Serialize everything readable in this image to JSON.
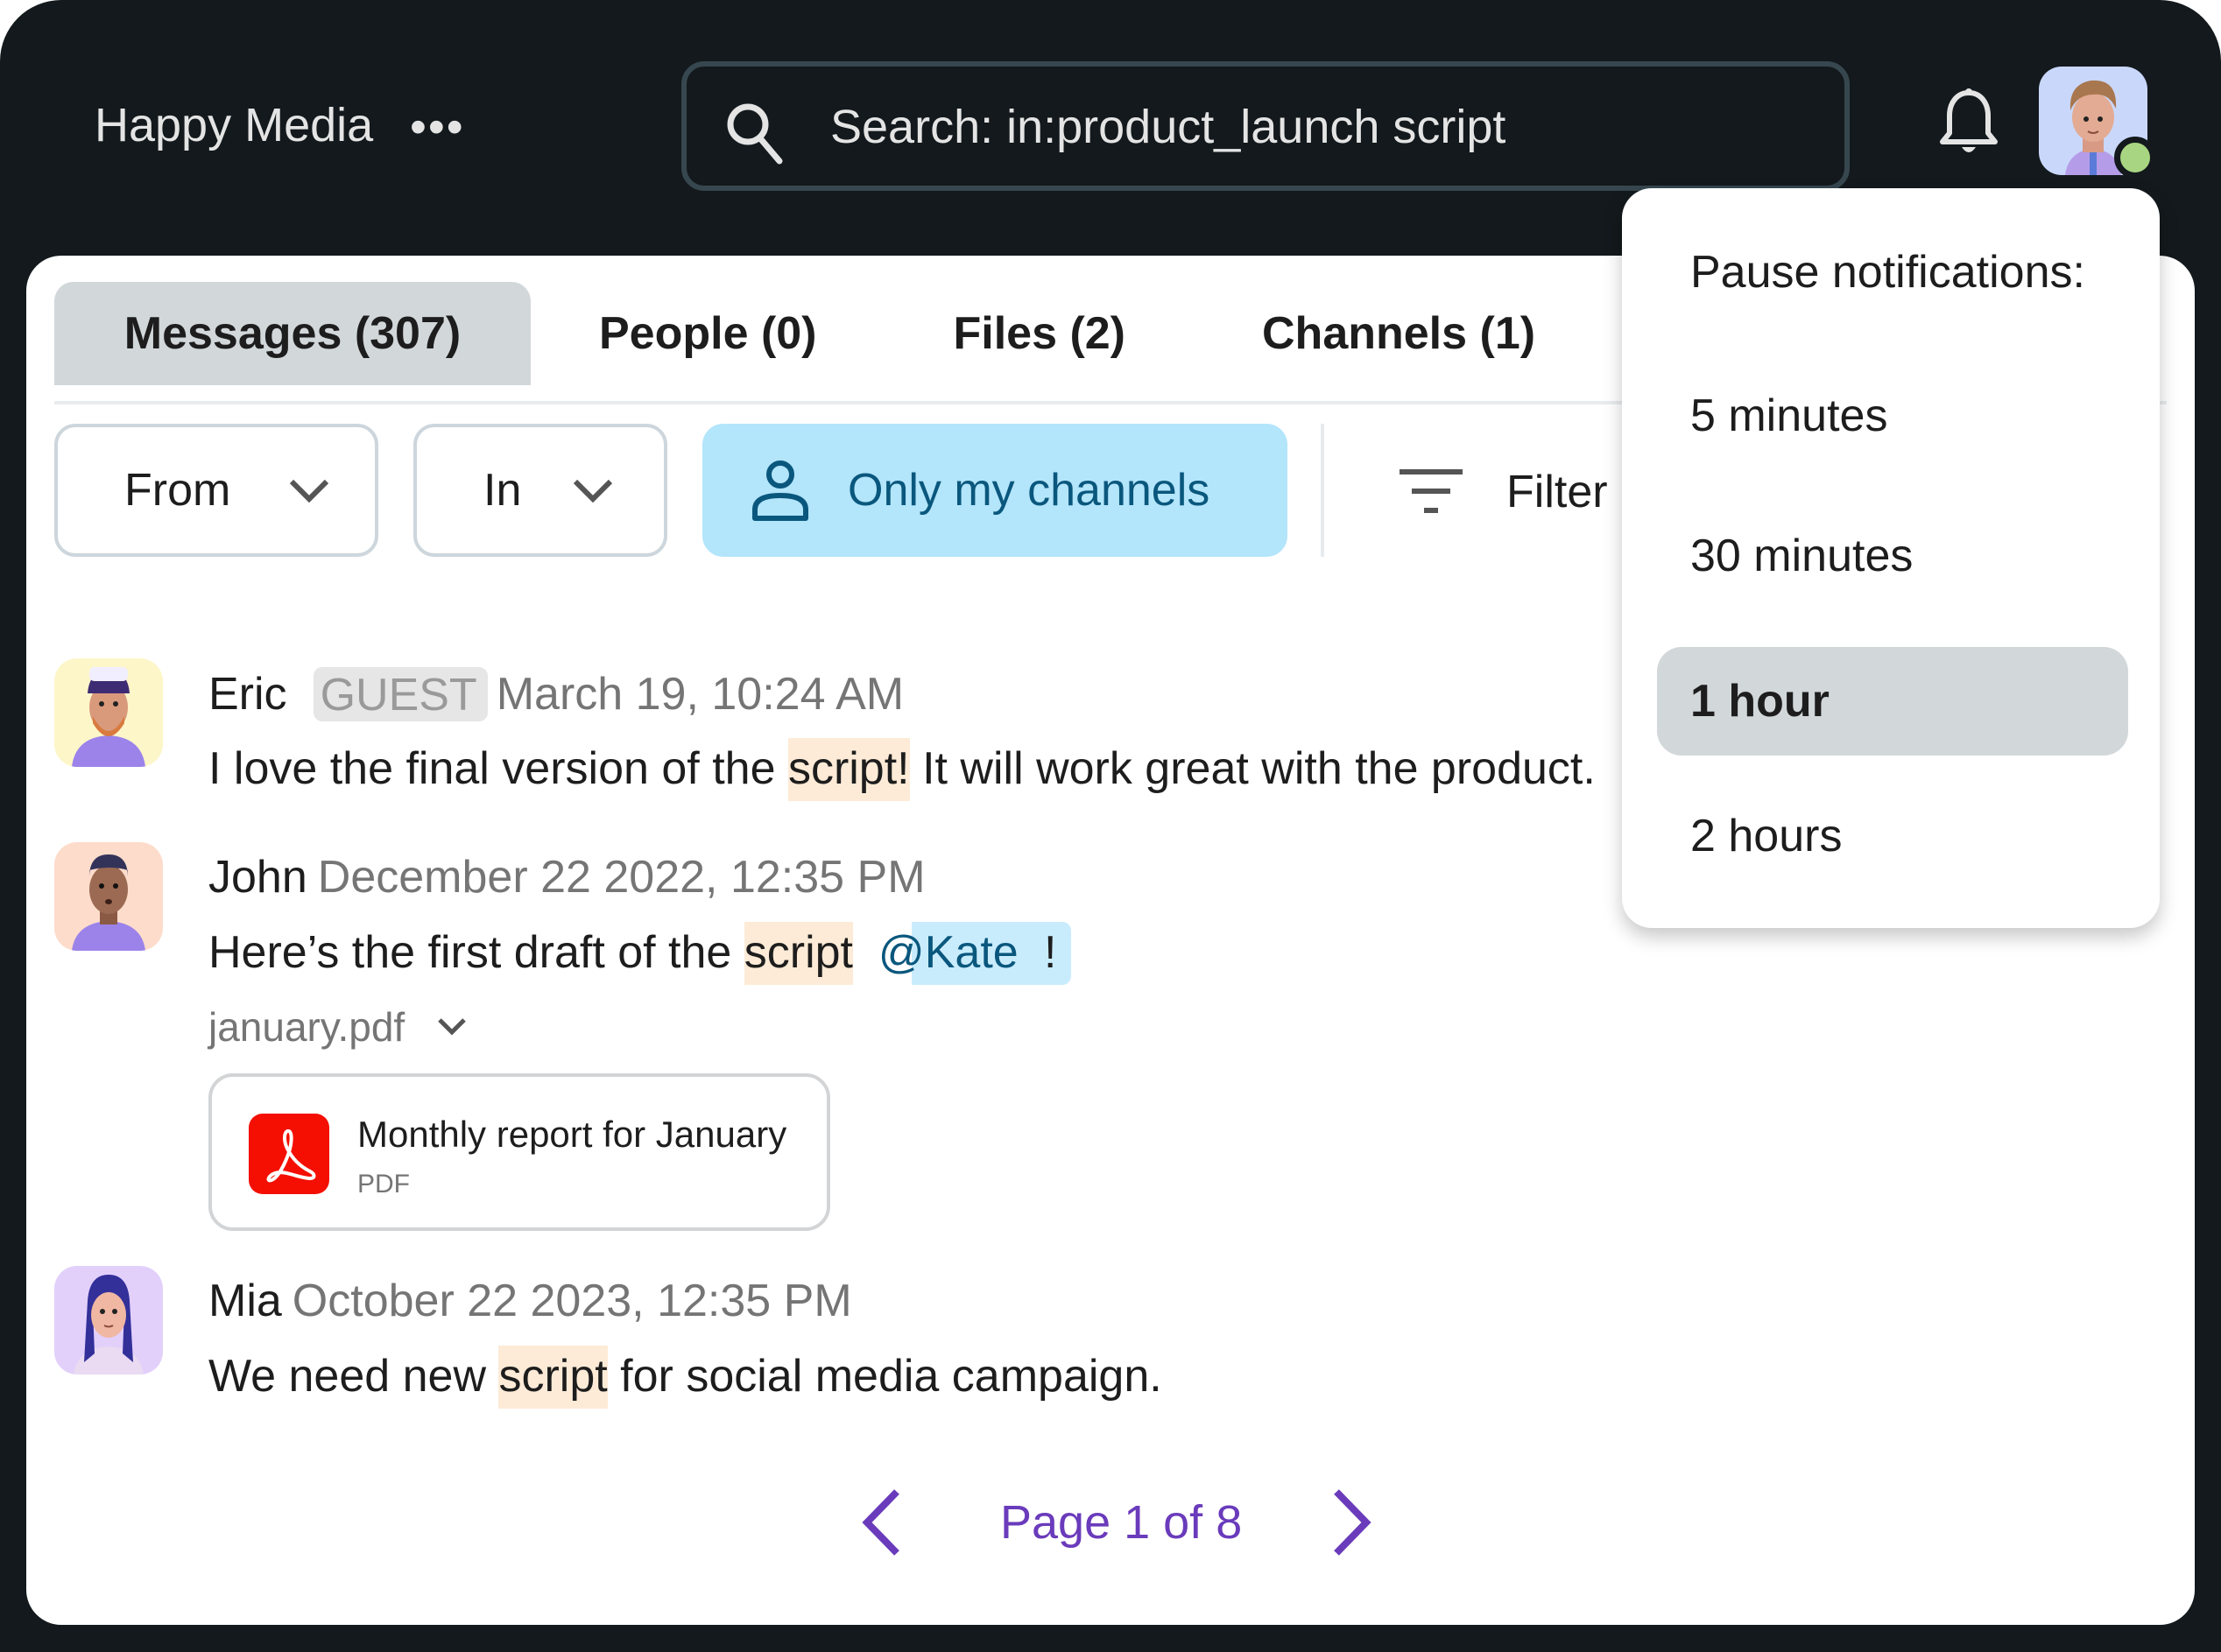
{
  "app": {
    "workspace_name": "Happy Media",
    "more_icon": "more-horizontal-icon"
  },
  "search": {
    "value": "Search: in:product_launch script",
    "icon": "search-icon"
  },
  "header": {
    "bell_icon": "bell-icon",
    "user_status": "online",
    "status_color": "#a8d581"
  },
  "tabs": [
    {
      "label": "Messages (307)",
      "active": true
    },
    {
      "label": "People (0)",
      "active": false
    },
    {
      "label": "Files (2)",
      "active": false
    },
    {
      "label": "Channels (1)",
      "active": false
    }
  ],
  "filters": {
    "from_label": "From",
    "in_label": "In",
    "only_my_channels_label": "Only my channels",
    "filter_label": "Filter"
  },
  "messages": [
    {
      "author": "Eric",
      "badge": "GUEST",
      "time": "March 19, 10:24 AM",
      "text_before": "I love the final version of the ",
      "highlight": "script!",
      "text_after": " It will work great with the product.",
      "avatar_bg": "#fdf6c9"
    },
    {
      "author": "John",
      "time": "December 22 2022, 12:35 PM",
      "text_before": "Here’s the first draft of the ",
      "highlight": "script",
      "mention": "@Kate",
      "text_after": " !",
      "avatar_bg": "#fddccb",
      "attachment": {
        "filename": "january.pdf",
        "card_title": "Monthly report for January",
        "card_type": "PDF"
      }
    },
    {
      "author": "Mia",
      "time": "October 22 2023, 12:35 PM",
      "text_before": "We need new ",
      "highlight": "script",
      "text_after": " for social media campaign.",
      "avatar_bg": "#e2d0fb"
    }
  ],
  "pagination": {
    "label": "Page 1 of 8",
    "current": 1,
    "total": 8
  },
  "pause_menu": {
    "title": "Pause notifications:",
    "options": [
      {
        "label": "5 minutes",
        "selected": false
      },
      {
        "label": "30 minutes",
        "selected": false
      },
      {
        "label": "1 hour",
        "selected": true
      },
      {
        "label": "2 hours",
        "selected": false
      }
    ]
  },
  "colors": {
    "accent_purple": "#6a3bbb",
    "highlight": "#fdebd7",
    "mention_bg": "#c9ecfd",
    "chip_active_bg": "#b3e5fb",
    "pdf_red": "#f40f02"
  }
}
